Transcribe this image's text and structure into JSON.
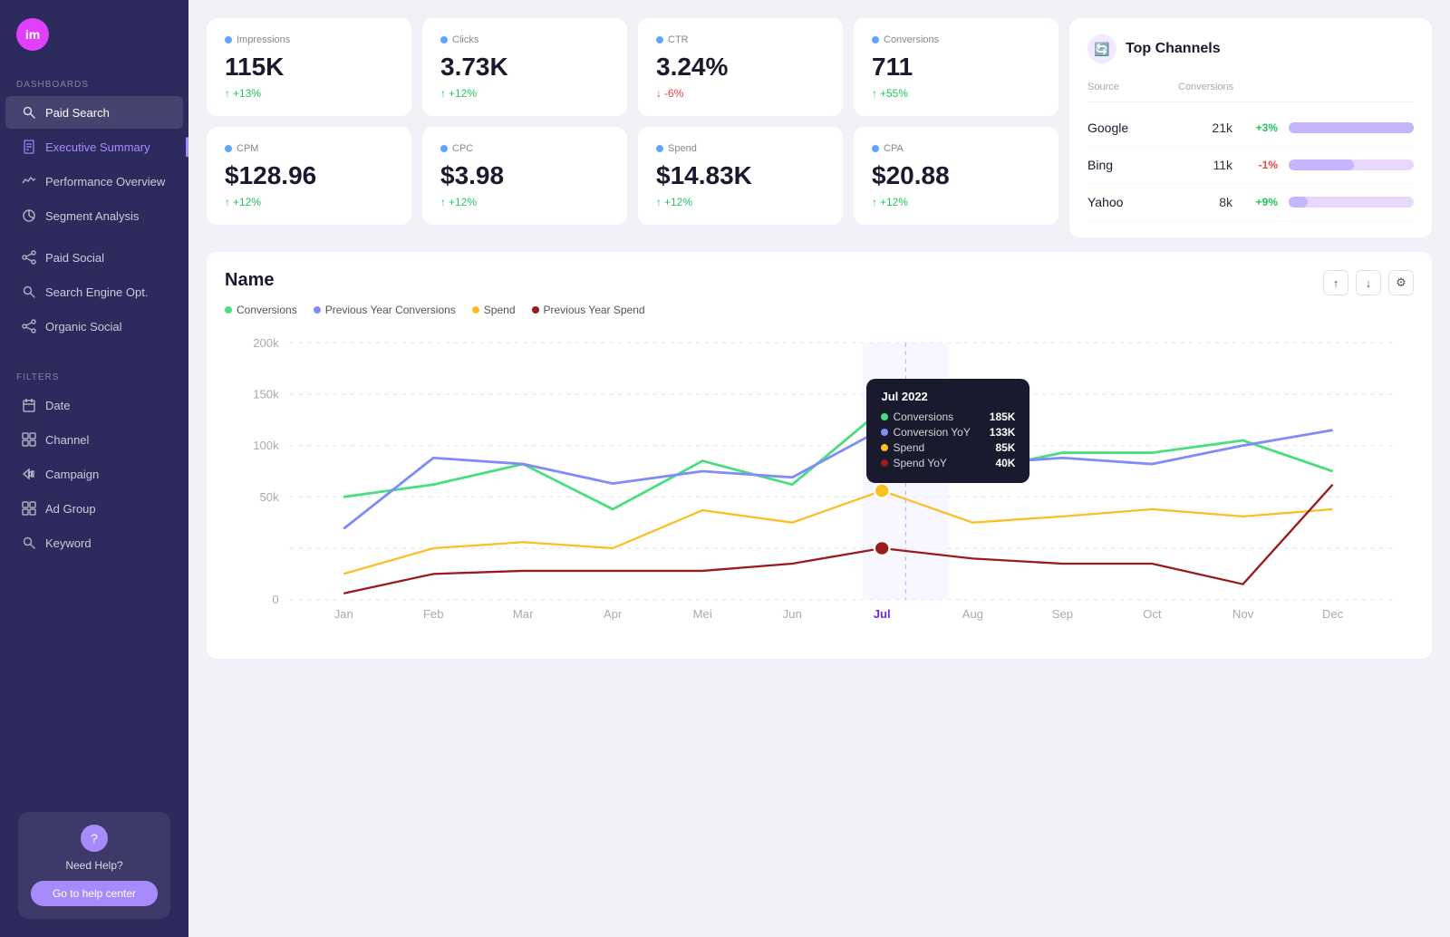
{
  "sidebar": {
    "logo_text": "im",
    "dashboards_label": "DASHBOARDS",
    "filters_label": "FILTERS",
    "items": [
      {
        "id": "paid-search",
        "label": "Paid Search",
        "icon": "search",
        "active": true
      },
      {
        "id": "executive-summary",
        "label": "Executive Summary",
        "icon": "file",
        "active_text": true
      },
      {
        "id": "performance-overview",
        "label": "Performance Overview",
        "icon": "activity",
        "active": false
      },
      {
        "id": "segment-analysis",
        "label": "Segment Analysis",
        "icon": "pie",
        "active": false
      },
      {
        "id": "paid-social",
        "label": "Paid Social",
        "icon": "social",
        "active": false
      },
      {
        "id": "search-engine-opt",
        "label": "Search Engine Opt.",
        "icon": "seo",
        "active": false
      },
      {
        "id": "organic-social",
        "label": "Organic Social",
        "icon": "organic",
        "active": false
      }
    ],
    "filters": [
      {
        "id": "date",
        "label": "Date",
        "icon": "calendar"
      },
      {
        "id": "channel",
        "label": "Channel",
        "icon": "channel"
      },
      {
        "id": "campaign",
        "label": "Campaign",
        "icon": "campaign"
      },
      {
        "id": "ad-group",
        "label": "Ad Group",
        "icon": "adgroup"
      },
      {
        "id": "keyword",
        "label": "Keyword",
        "icon": "keyword"
      }
    ],
    "help": {
      "title": "Need Help?",
      "button_label": "Go to help center"
    }
  },
  "metrics": {
    "row1": [
      {
        "id": "impressions",
        "label": "Impressions",
        "dot_color": "#60a5fa",
        "value": "115K",
        "change": "+13%",
        "direction": "up"
      },
      {
        "id": "clicks",
        "label": "Clicks",
        "dot_color": "#60a5fa",
        "value": "3.73K",
        "change": "+12%",
        "direction": "up"
      },
      {
        "id": "ctr",
        "label": "CTR",
        "dot_color": "#60a5fa",
        "value": "3.24%",
        "change": "-6%",
        "direction": "down"
      },
      {
        "id": "conversions",
        "label": "Conversions",
        "dot_color": "#60a5fa",
        "value": "711",
        "change": "+55%",
        "direction": "up"
      }
    ],
    "row2": [
      {
        "id": "cpm",
        "label": "CPM",
        "dot_color": "#60a5fa",
        "value": "$128.96",
        "change": "+12%",
        "direction": "up"
      },
      {
        "id": "cpc",
        "label": "CPC",
        "dot_color": "#60a5fa",
        "value": "$3.98",
        "change": "+12%",
        "direction": "up"
      },
      {
        "id": "spend",
        "label": "Spend",
        "dot_color": "#60a5fa",
        "value": "$14.83K",
        "change": "+12%",
        "direction": "up"
      },
      {
        "id": "cpa",
        "label": "CPA",
        "dot_color": "#60a5fa",
        "value": "$20.88",
        "change": "+12%",
        "direction": "up"
      }
    ]
  },
  "top_channels": {
    "title": "Top Channels",
    "icon": "⟳",
    "col_source": "Source",
    "col_conversions": "Conversions",
    "rows": [
      {
        "source": "Google",
        "conversions": "21k",
        "change": "+3%",
        "change_type": "pos",
        "bar_pct": 100
      },
      {
        "source": "Bing",
        "conversions": "11k",
        "change": "-1%",
        "change_type": "neg",
        "bar_pct": 52
      },
      {
        "source": "Yahoo",
        "conversions": "8k",
        "change": "+9%",
        "change_type": "pos",
        "bar_pct": 15
      }
    ]
  },
  "chart": {
    "title": "Name",
    "legend": [
      {
        "label": "Conversions",
        "color": "#4ade80"
      },
      {
        "label": "Previous Year Conversions",
        "color": "#818cf8"
      },
      {
        "label": "Spend",
        "color": "#fbbf24"
      },
      {
        "label": "Previous Year Spend",
        "color": "#991b1b"
      }
    ],
    "x_labels": [
      "Jan",
      "Feb",
      "Mar",
      "Apr",
      "Mei",
      "Jun",
      "Jul",
      "Aug",
      "Sep",
      "Oct",
      "Nov",
      "Dec"
    ],
    "y_labels": [
      "0",
      "50k",
      "100k",
      "150k",
      "200k"
    ],
    "tooltip": {
      "title": "Jul 2022",
      "rows": [
        {
          "label": "Conversions",
          "color": "#4ade80",
          "value": "185K"
        },
        {
          "label": "Conversion YoY",
          "color": "#818cf8",
          "value": "133K"
        },
        {
          "label": "Spend",
          "color": "#fbbf24",
          "value": "85K"
        },
        {
          "label": "Spend YoY",
          "color": "#991b1b",
          "value": "40K"
        }
      ]
    },
    "controls": {
      "up": "↑",
      "down": "↓",
      "settings": "⚙"
    }
  }
}
